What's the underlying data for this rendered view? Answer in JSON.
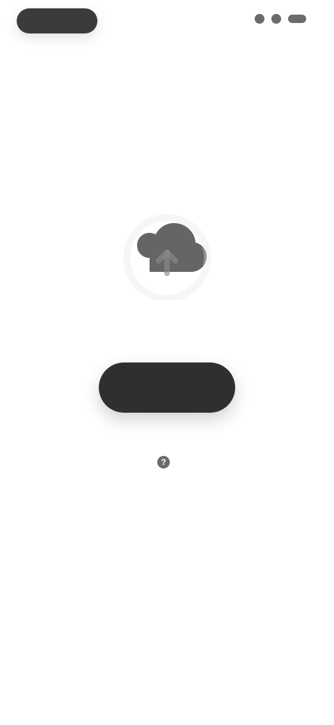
{
  "status_bar": {
    "left_label": "",
    "right_items": [
      "signal",
      "wifi",
      "battery"
    ]
  },
  "hero": {
    "icon": "cloud-upload-icon",
    "title": "",
    "subtitle": ""
  },
  "actions": {
    "primary_label": "",
    "secondary_label": "",
    "help_label": ""
  },
  "colors": {
    "primary_dark": "#2f2f2f",
    "muted_text": "#7a7a7a",
    "background": "#ffffff"
  }
}
